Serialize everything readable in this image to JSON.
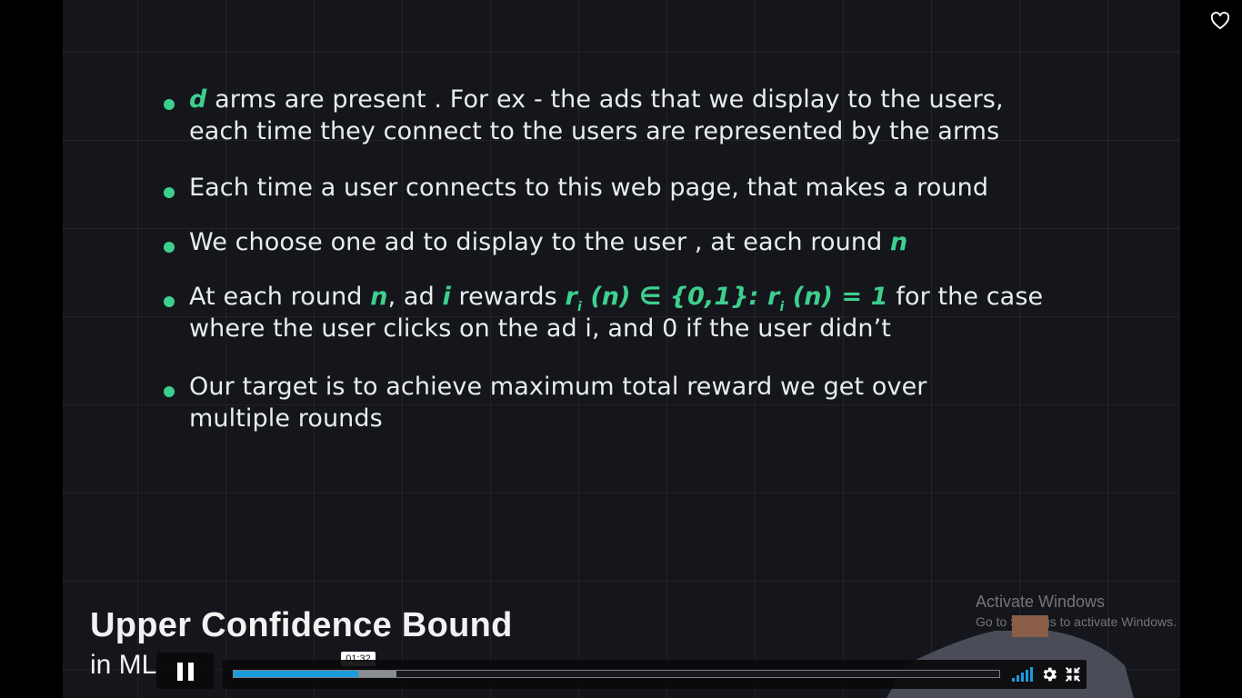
{
  "slide": {
    "bullets": [
      {
        "line1": [
          {
            "t": "d",
            "hl": true
          },
          {
            "t": " arms are present . For ex - the ads that we display to the users,",
            "hl": false
          }
        ],
        "line2": [
          {
            "t": "each time they connect to the users are represented by the arms",
            "hl": false
          }
        ]
      },
      {
        "line1": [
          {
            "t": "Each time a user connects to this web page, that makes a round",
            "hl": false
          }
        ]
      },
      {
        "line1": [
          {
            "t": "We choose one ad to display to the user , at each round ",
            "hl": false
          },
          {
            "t": "n",
            "hl": true
          }
        ]
      },
      {
        "line1": [
          {
            "t": "At each round ",
            "hl": false
          },
          {
            "t": "n",
            "hl": true
          },
          {
            "t": ", ad ",
            "hl": false
          },
          {
            "t": "i",
            "hl": true
          },
          {
            "t": " rewards ",
            "hl": false
          },
          {
            "t": "r",
            "hl": true
          },
          {
            "t": "i",
            "sub": true
          },
          {
            "t": " (n) ∈ {0,1}: r",
            "hl": true
          },
          {
            "t": "i",
            "sub": true
          },
          {
            "t": " (n) = 1",
            "hl": true
          },
          {
            "t": " for the case",
            "hl": false
          }
        ],
        "line2": [
          {
            "t": "where the user clicks on the ad i, and 0 if the user didn’t",
            "hl": false
          }
        ]
      },
      {
        "line1": [
          {
            "t": "Our target is to achieve maximum total reward we get over",
            "hl": false
          }
        ],
        "line2": [
          {
            "t": "multiple rounds",
            "hl": false
          }
        ]
      }
    ]
  },
  "video": {
    "title": "Upper Confidence Bound",
    "subtitle": "in ML",
    "tooltip_time": "01:32",
    "progress_played_fraction": 0.163,
    "progress_buffered_fraction": 0.212,
    "volume_level": 1.0
  },
  "watermark": {
    "title": "Activate Windows",
    "subtitle": "Go to Settings to activate Windows."
  },
  "colors": {
    "accent": "#3ecf8e",
    "progress": "#1a9be0",
    "buffer": "#8b8e94"
  }
}
